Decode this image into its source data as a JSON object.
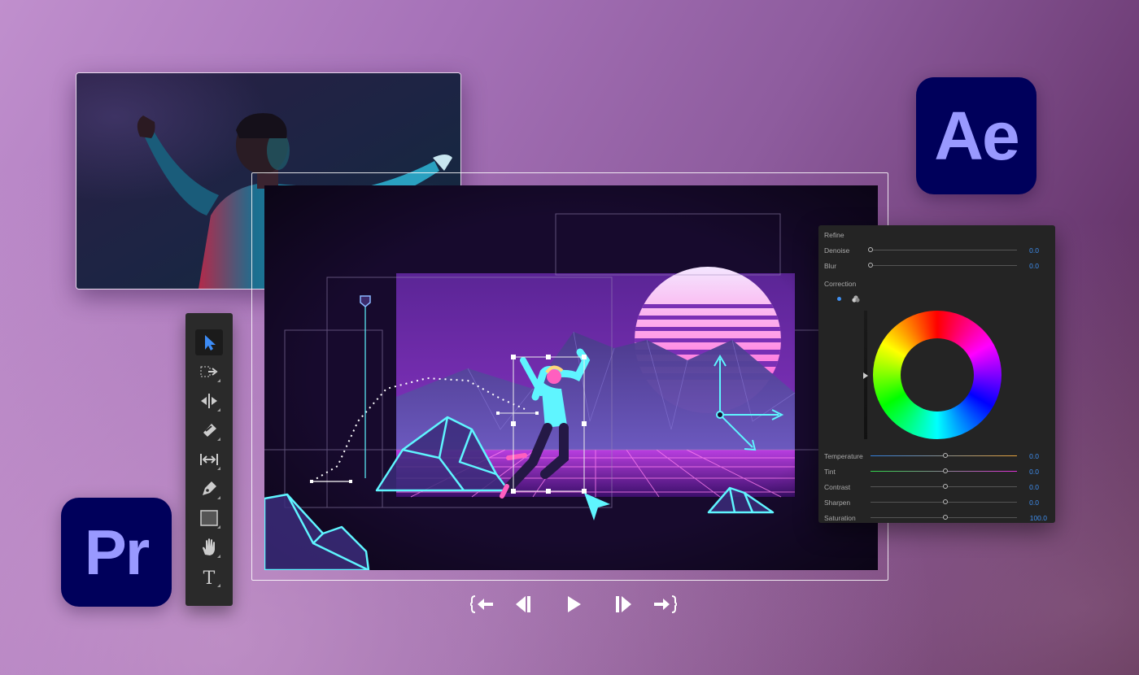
{
  "apps": {
    "after_effects": "Ae",
    "premiere": "Pr"
  },
  "colors": {
    "app_icon_bg": "#00005b",
    "app_icon_text": "#9999ff",
    "value_blue": "#3f8ff0",
    "neon_cyan": "#5ff5ff"
  },
  "panel": {
    "refine_header": "Refine",
    "denoise_label": "Denoise",
    "denoise_value": "0.0",
    "blur_label": "Blur",
    "blur_value": "0.0",
    "correction_header": "Correction",
    "temperature_label": "Temperature",
    "temperature_value": "0.0",
    "tint_label": "Tint",
    "tint_value": "0.0",
    "contrast_label": "Contrast",
    "contrast_value": "0.0",
    "sharpen_label": "Sharpen",
    "sharpen_value": "0.0",
    "saturation_label": "Saturation",
    "saturation_value": "100.0"
  },
  "tools": [
    "selection-tool",
    "track-select-tool",
    "ripple-edit-tool",
    "razor-tool",
    "slip-tool",
    "pen-tool",
    "rectangle-tool",
    "hand-tool",
    "type-tool"
  ],
  "transport": [
    "go-to-in-icon",
    "step-back-icon",
    "play-icon",
    "step-forward-icon",
    "go-to-out-icon"
  ],
  "type_tool_glyph": "T"
}
